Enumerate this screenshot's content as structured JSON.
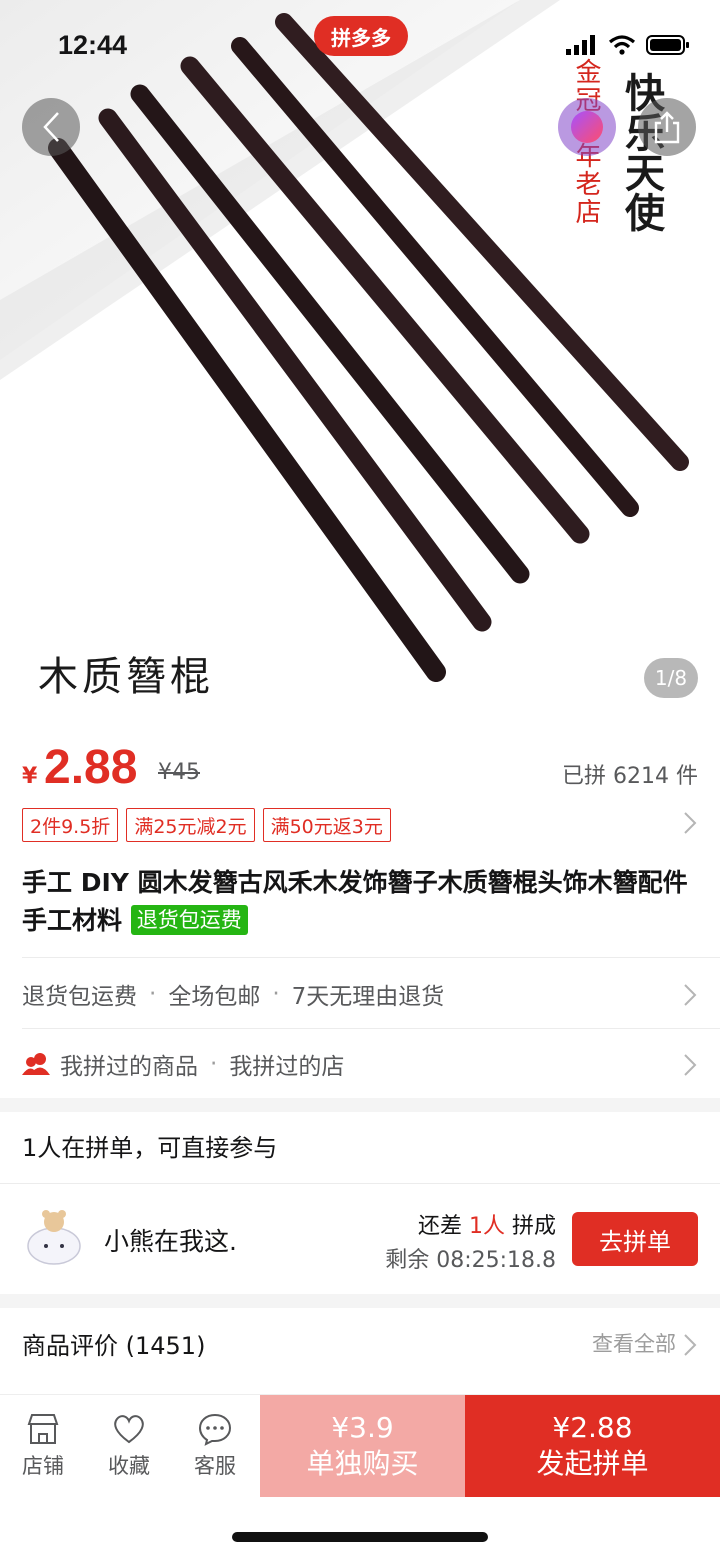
{
  "status_bar": {
    "time": "12:44"
  },
  "app_badge": "拼多多",
  "hero": {
    "overlay_label": "木质簪棍",
    "page_indicator": "1/8",
    "shop_stamp": "金冠十年老店",
    "shop_calligraphy": "快乐天使"
  },
  "price": {
    "currency": "¥",
    "current": "2.88",
    "original": "¥45",
    "sold": "已拼 6214 件"
  },
  "coupons": [
    "2件9.5折",
    "满25元减2元",
    "满50元返3元"
  ],
  "product": {
    "title": "手工 DIY 圆木发簪古风禾木发饰簪子木质簪棍头饰木簪配件手工材料",
    "return_badge": "退货包运费"
  },
  "services": [
    "退货包运费",
    "全场包邮",
    "7天无理由退货"
  ],
  "history": [
    "我拼过的商品",
    "我拼过的店"
  ],
  "group": {
    "header": "1人在拼单，可直接参与",
    "user": "小熊在我这.",
    "need_prefix": "还差",
    "need_count": "1人",
    "need_suffix": "拼成",
    "remaining": "剩余 08:25:18.8",
    "join_label": "去拼单"
  },
  "reviews": {
    "title": "商品评价 (1451)",
    "view_all": "查看全部"
  },
  "bottom_bar": {
    "shop": "店铺",
    "favorite": "收藏",
    "service": "客服",
    "solo_price": "¥3.9",
    "solo_label": "单独购买",
    "group_price": "¥2.88",
    "group_label": "发起拼单"
  },
  "colors": {
    "brand_red": "#e02e24",
    "solo_pink": "#f3a9a5",
    "badge_green": "#25b513",
    "wood_dark": "#2a1a1c"
  }
}
